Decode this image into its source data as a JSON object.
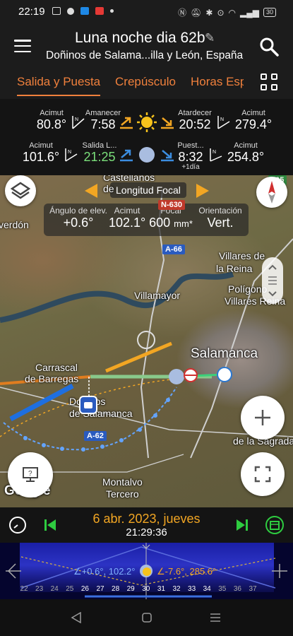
{
  "status": {
    "time": "22:19",
    "battery": "30"
  },
  "header": {
    "title": "Luna noche dia 62b",
    "subtitle": "Doñinos de Salama...illa y León, España"
  },
  "tabs": [
    {
      "label": "Salida y Puesta",
      "active": true
    },
    {
      "label": "Crepúsculo",
      "active": false
    },
    {
      "label": "Horas Esp",
      "active": false
    }
  ],
  "sun": {
    "rise_azimuth_label": "Acimut",
    "rise_azimuth": "80.8°",
    "sunrise_label": "Amanecer",
    "sunrise": "7:58",
    "sunset_label": "Atardecer",
    "sunset": "20:52",
    "set_azimuth_label": "Acimut",
    "set_azimuth": "279.4°"
  },
  "moon": {
    "rise_azimuth_label": "Acimut",
    "rise_azimuth": "101.6°",
    "moonrise_label": "Salida L...",
    "moonrise": "21:25",
    "moonset_label": "Puest...",
    "moonset": "8:32",
    "moonset_note": "+1día",
    "set_azimuth_label": "Acimut",
    "set_azimuth": "254.8°"
  },
  "map": {
    "focal_label": "Longitud Focal",
    "params": {
      "elev_label": "Ángulo de elev.",
      "elev": "+0.6°",
      "azimuth_label": "Acimut",
      "azimuth": "102.1°",
      "focal_label": "Focal",
      "focal": "600",
      "focal_unit": "mm*",
      "orientation_label": "Orientación",
      "orientation": "Vert."
    },
    "places": {
      "castellanos": "Castellanos",
      "de_moriscos": "de",
      "verdon": "verdón",
      "villares_reina_1": "Villares de",
      "villares_reina_2": "la Reina",
      "poligono_1": "Polígono",
      "poligono_2": "Villares Reina",
      "villamayor": "Villamayor",
      "salamanca": "Salamanca",
      "carrascal_1": "Carrascal",
      "carrascal_2": "de Barregas",
      "donnos_1": "Doñinos",
      "donnos_2": "de Salamanca",
      "montalvo_1": "Montalvo",
      "montalvo_2": "Tercero",
      "sagrada": "de la Sagrada",
      "google": "Google"
    },
    "roads": {
      "n630": "N-630",
      "a66": "A-66",
      "a62": "A-62",
      "top_right": "605"
    }
  },
  "datebar": {
    "date": "6 abr. 2023, jueves",
    "time": "21:29:36"
  },
  "timeline": {
    "left_info": "∠+0.6°, 102.2°",
    "right_info": "∠-7.6°, 285.6°",
    "hours": [
      "22",
      "23",
      "24",
      "25",
      "26",
      "27",
      "28",
      "29",
      "30",
      "31",
      "32",
      "33",
      "34",
      "35",
      "36",
      "37"
    ]
  },
  "colors": {
    "accent": "#f0803c",
    "date": "#f2a623",
    "moonrise": "#7be07b"
  }
}
